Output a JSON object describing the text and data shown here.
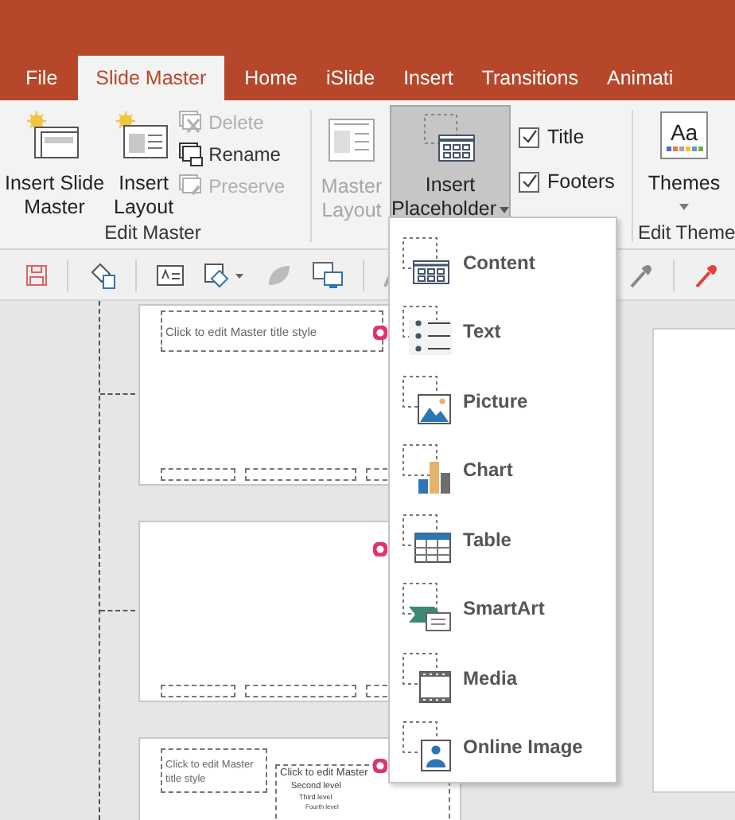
{
  "tabs": [
    {
      "label": "File",
      "selected": false
    },
    {
      "label": "Slide Master",
      "selected": true
    },
    {
      "label": "Home",
      "selected": false
    },
    {
      "label": "iSlide",
      "selected": false
    },
    {
      "label": "Insert",
      "selected": false
    },
    {
      "label": "Transitions",
      "selected": false
    },
    {
      "label": "Animati",
      "selected": false
    }
  ],
  "edit_master": {
    "label": "Edit Master",
    "large_buttons": [
      {
        "label": "Insert Slide\nMaster",
        "kind": "slide-master"
      },
      {
        "label": "Insert\nLayout",
        "kind": "layout"
      }
    ],
    "small_buttons": [
      {
        "label": "Delete",
        "disabled": true,
        "kind": "delete"
      },
      {
        "label": "Rename",
        "disabled": false,
        "kind": "rename"
      },
      {
        "label": "Preserve",
        "disabled": true,
        "kind": "preserve"
      }
    ]
  },
  "master_layout": {
    "master_layout_button": {
      "label": "Master\nLayout",
      "disabled": true
    },
    "insert_placeholder_button": {
      "label": "Insert\nPlaceholder",
      "expanded": true
    },
    "checkboxes": [
      {
        "label": "Title",
        "checked": true
      },
      {
        "label": "Footers",
        "checked": true
      }
    ]
  },
  "edit_theme": {
    "label": "Edit Theme",
    "themes_button": {
      "label": "Themes",
      "icon_text": "Aa"
    }
  },
  "placeholder_menu": {
    "items": [
      {
        "label": "Content",
        "kind": "content"
      },
      {
        "label": "Text",
        "kind": "text"
      },
      {
        "label": "Picture",
        "kind": "picture"
      },
      {
        "label": "Chart",
        "kind": "chart"
      },
      {
        "label": "Table",
        "kind": "table"
      },
      {
        "label": "SmartArt",
        "kind": "smartart"
      },
      {
        "label": "Media",
        "kind": "media"
      },
      {
        "label": "Online Image",
        "kind": "online-image"
      }
    ]
  },
  "thumbnails": [
    {
      "kind": "title-only",
      "title": "Click to edit Master title style"
    },
    {
      "kind": "blank"
    },
    {
      "kind": "two-content",
      "title": "Click to edit Master title style",
      "body": [
        "Click to edit Master",
        "Second level",
        "Third level",
        "Fourth level"
      ]
    }
  ]
}
